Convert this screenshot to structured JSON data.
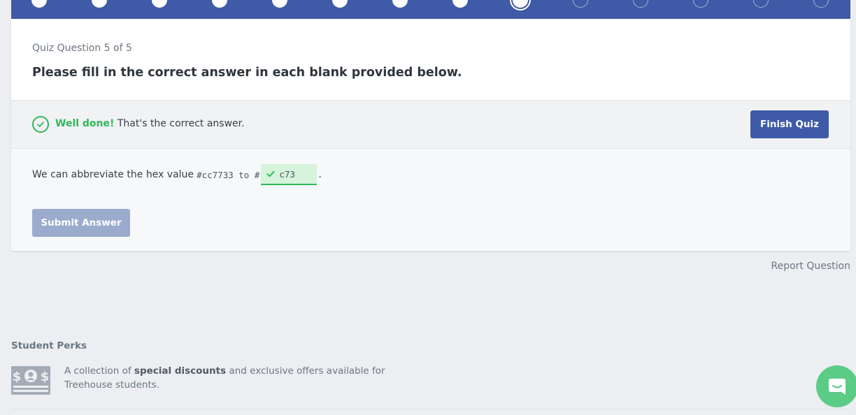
{
  "progress": {
    "total_steps": 14,
    "completed_steps": 8,
    "current_step": 9
  },
  "question": {
    "meta": "Quiz Question 5 of 5",
    "prompt": "Please fill in the correct answer in each blank provided below."
  },
  "feedback": {
    "strong": "Well done!",
    "message": "That's the correct answer.",
    "status_color": "#2fb85a"
  },
  "finish_label": "Finish Quiz",
  "answer": {
    "prefix": "We can abbreviate the hex value",
    "code": "#cc7733 to #",
    "blank_value": "c73",
    "suffix": "."
  },
  "submit_label": "Submit Answer",
  "report_label": "Report Question",
  "perks": {
    "title": "Student Perks",
    "text_before": "A collection of",
    "text_strong": "special discounts",
    "text_after": "and exclusive offers available for Treehouse students."
  },
  "colors": {
    "accent": "#3f5aa6",
    "success": "#2fb85a",
    "chat": "#5ccb86"
  },
  "icons": {
    "feedback": "check-circle-icon",
    "blank": "checkmark-icon",
    "perks": "money-icon",
    "chat": "chat-icon"
  }
}
